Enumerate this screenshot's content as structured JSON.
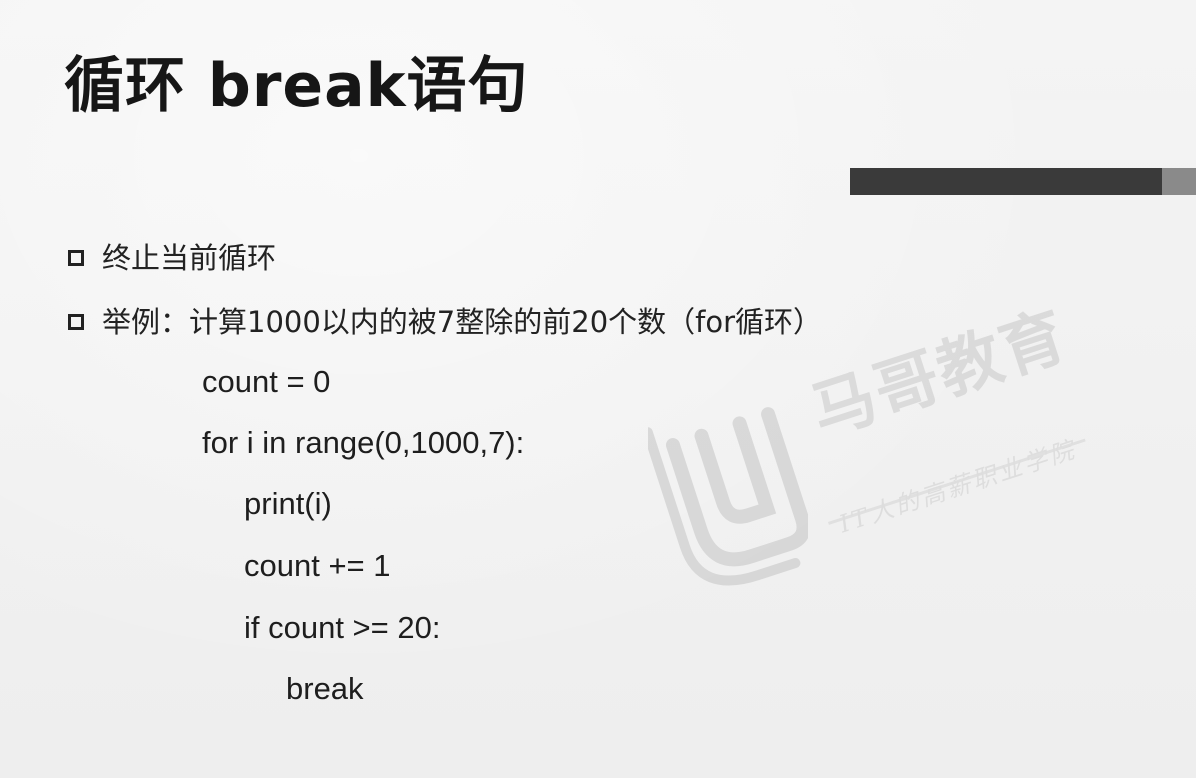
{
  "slide": {
    "title": "循环 break语句",
    "bullets": [
      "终止当前循环",
      "举例：计算1000以内的被7整除的前20个数（for循环）"
    ],
    "code": [
      "count = 0",
      "for i in range(0,1000,7):",
      "print(i)",
      "count += 1",
      "if count >= 20:",
      "break"
    ]
  },
  "watermark": {
    "brand": "马哥教育",
    "tagline": "IT人的高薪职业学院"
  },
  "colors": {
    "accent_bar": "#3a3a3a",
    "accent_bar_tail": "#8a8a8a",
    "text": "#1b1b1b"
  },
  "icons": {
    "bullet": "square-outline-icon",
    "watermark_logo": "magedu-logo-icon"
  }
}
